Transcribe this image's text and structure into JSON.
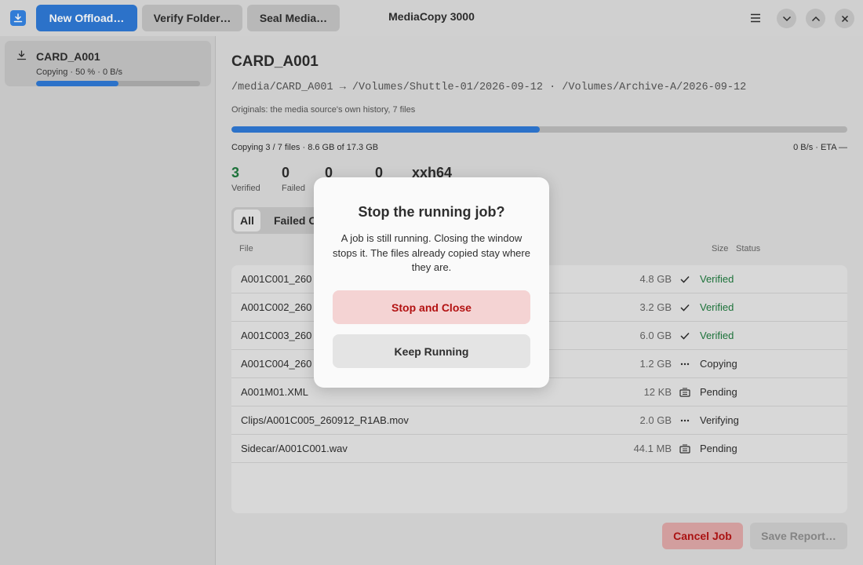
{
  "app": {
    "title": "MediaCopy 3000",
    "icon": "download-tray-icon",
    "accent_color": "#2f7ad6"
  },
  "toolbar": {
    "new_offload_label": "New Offload…",
    "verify_folder_label": "Verify Folder…",
    "seal_media_label": "Seal Media…"
  },
  "sidebar": {
    "jobs": [
      {
        "name": "CARD_A001",
        "status": "Copying · 50 % · 0 B/s",
        "progress": 0.5
      }
    ]
  },
  "job": {
    "title": "CARD_A001",
    "paths": "/media/CARD_A001 → /Volumes/Shuttle-01/2026-09-12 · /Volumes/Archive-A/2026-09-12",
    "description": "Originals: the media source's own history, 7 files",
    "progress": 0.5,
    "progress_text": "Copying 3 / 7 files · 8.6 GB of 17.3 GB",
    "rate_text": "0 B/s · ETA —"
  },
  "stats": [
    {
      "value": "3",
      "label": "Verified",
      "color": "#1f7a3e"
    },
    {
      "value": "0",
      "label": "Failed"
    },
    {
      "value": "0",
      "label": ""
    },
    {
      "value": "0",
      "label": ""
    },
    {
      "value": "xxh64",
      "label": ""
    }
  ],
  "tabs": [
    {
      "label": "All",
      "active": true
    },
    {
      "label": "Failed O"
    }
  ],
  "columns": {
    "file": "File",
    "size": "Size",
    "status": "Status"
  },
  "files": [
    {
      "name": "A001C001_260",
      "size": "4.8 GB",
      "icon": "checkmark-icon",
      "status": "Verified",
      "status_color": "#1f7a3e"
    },
    {
      "name": "A001C002_260",
      "size": "3.2 GB",
      "icon": "checkmark-icon",
      "status": "Verified",
      "status_color": "#1f7a3e"
    },
    {
      "name": "A001C003_260",
      "size": "6.0 GB",
      "icon": "checkmark-icon",
      "status": "Verified",
      "status_color": "#1f7a3e"
    },
    {
      "name": "A001C004_260",
      "size": "1.2 GB",
      "icon": "ellipsis-icon",
      "status": "Copying"
    },
    {
      "name": "A001M01.XML",
      "size": "12 KB",
      "icon": "pending-tray-icon",
      "status": "Pending"
    },
    {
      "name": "Clips/A001C005_260912_R1AB.mov",
      "size": "2.0 GB",
      "icon": "ellipsis-icon",
      "status": "Verifying"
    },
    {
      "name": "Sidecar/A001C001.wav",
      "size": "44.1 MB",
      "icon": "pending-tray-icon",
      "status": "Pending"
    }
  ],
  "footer": {
    "cancel_label": "Cancel Job",
    "save_label": "Save Report…"
  },
  "dialog": {
    "title": "Stop the running job?",
    "body": "A job is still running. Closing the window stops it. The files already copied stay where they are.",
    "stop_label": "Stop and Close",
    "keep_label": "Keep Running"
  }
}
